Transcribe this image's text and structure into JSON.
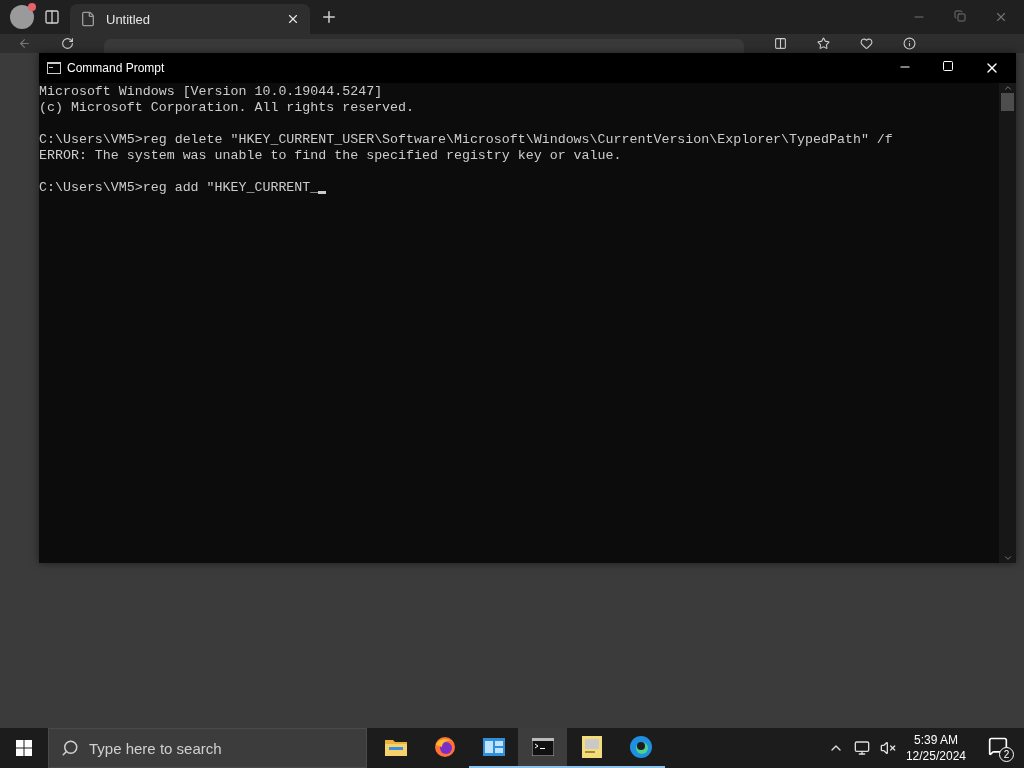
{
  "browser": {
    "tab": {
      "title": "Untitled",
      "selected": true
    }
  },
  "console": {
    "title": "Command Prompt",
    "cursor": true,
    "blocks": [
      [
        "Microsoft Windows [Version 10.0.19044.5247]",
        "(c) Microsoft Corporation. All rights reserved."
      ],
      [
        "C:\\Users\\VM5>reg delete \"HKEY_CURRENT_USER\\Software\\Microsoft\\Windows\\CurrentVersion\\Explorer\\TypedPath\" /f",
        "ERROR: The system was unable to find the specified registry key or value."
      ],
      [
        "C:\\Users\\VM5>reg add \"HKEY_CURRENT_"
      ]
    ]
  },
  "taskbar": {
    "search": {
      "placeholder": "Type here to search"
    },
    "apps": [
      {
        "kind": "folder",
        "running": false,
        "selected": false
      },
      {
        "kind": "firefox",
        "running": false,
        "selected": false
      },
      {
        "kind": "panel",
        "running": true,
        "selected": false
      },
      {
        "kind": "terminal",
        "running": true,
        "selected": true
      },
      {
        "kind": "notes",
        "running": true,
        "selected": false
      },
      {
        "kind": "edge",
        "running": true,
        "selected": false
      }
    ],
    "time": "5:39 AM",
    "date": "12/25/2024",
    "notifications": "2"
  }
}
